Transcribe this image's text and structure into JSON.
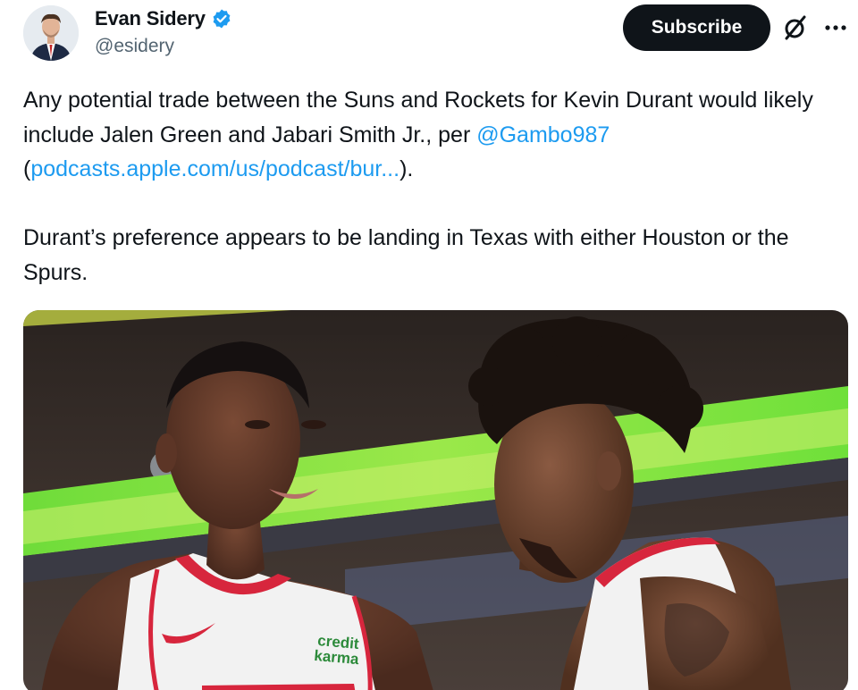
{
  "author": {
    "display_name": "Evan Sidery",
    "handle": "@esidery",
    "verified": true
  },
  "actions": {
    "subscribe_label": "Subscribe",
    "grok_icon": "grok-icon",
    "more_icon": "more-horizontal-icon"
  },
  "tweet": {
    "p1_part1": "Any potential trade between the Suns and Rockets for Kevin Durant would likely include Jalen Green and Jabari Smith Jr., per ",
    "mention": "@Gambo987",
    "p1_part2": " (",
    "link_text": "podcasts.apple.com/us/podcast/bur...",
    "p1_part3": ").",
    "p2": "Durant’s preference appears to be landing in Texas with either Houston or the Spurs."
  },
  "media": {
    "jersey_text_line1": "credit",
    "jersey_text_line2": "karma"
  },
  "colors": {
    "link": "#1d9bf0",
    "verified": "#1d9bf0",
    "button_bg": "#0f1419",
    "secondary_text": "#536471"
  }
}
